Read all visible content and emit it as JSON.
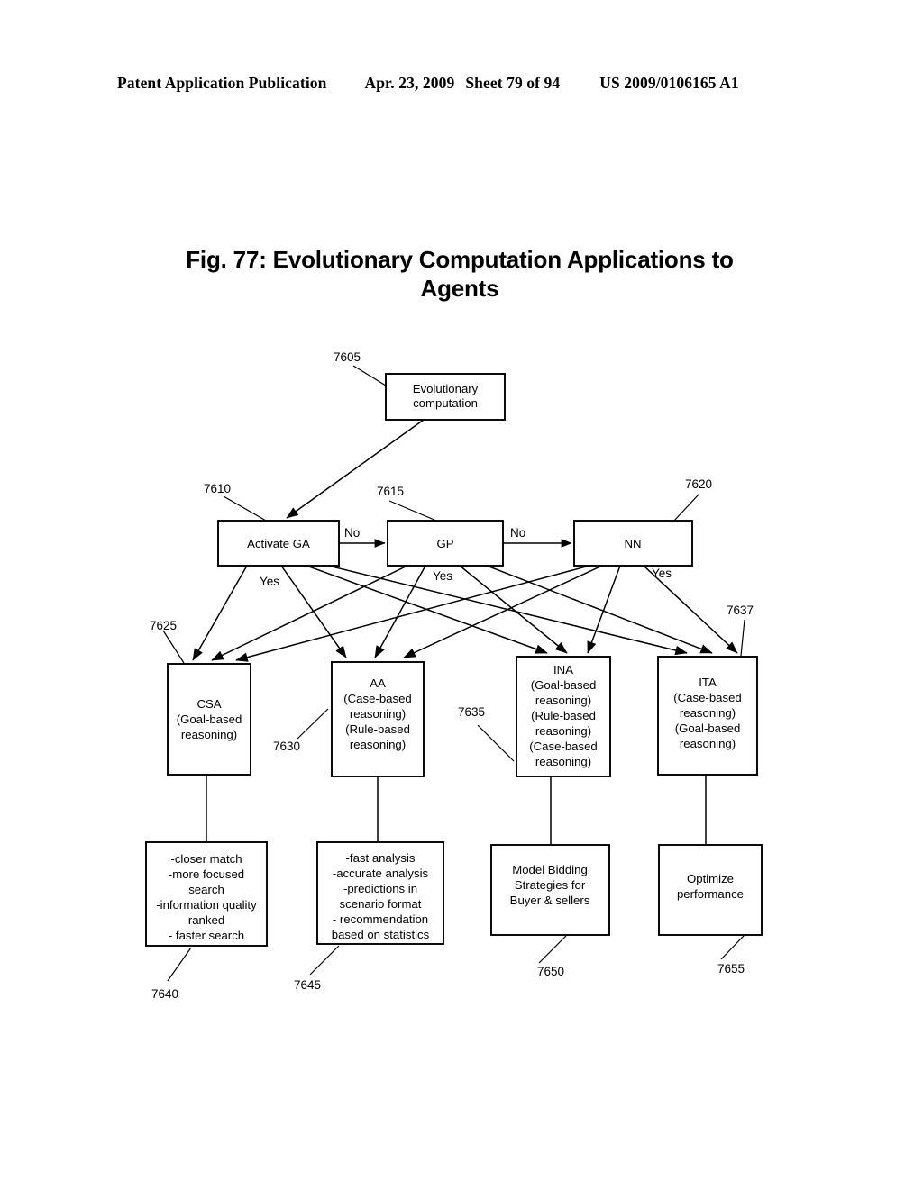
{
  "header": {
    "publication": "Patent Application Publication",
    "date": "Apr. 23, 2009",
    "sheet": "Sheet 79 of 94",
    "patent_number": "US 2009/0106165 A1"
  },
  "figure": {
    "title_line1": "Fig. 77: Evolutionary Computation Applications to",
    "title_line2": "Agents"
  },
  "nodes": {
    "evolutionary_computation": {
      "ref": "7605",
      "lines": [
        "Evolutionary",
        "computation"
      ]
    },
    "activate_ga": {
      "ref": "7610",
      "lines": [
        "Activate GA"
      ]
    },
    "gp": {
      "ref": "7615",
      "lines": [
        "GP"
      ]
    },
    "nn": {
      "ref": "7620",
      "lines": [
        "NN"
      ]
    },
    "csa": {
      "ref": "7625",
      "lines": [
        "CSA",
        "(Goal-based",
        "reasoning)"
      ]
    },
    "aa": {
      "ref": "7630",
      "lines": [
        "AA",
        "(Case-based",
        "reasoning)",
        "(Rule-based",
        "reasoning)"
      ]
    },
    "ina": {
      "ref": "7635",
      "lines": [
        "INA",
        "(Goal-based",
        "reasoning)",
        "(Rule-based",
        "reasoning)",
        "(Case-based",
        "reasoning)"
      ]
    },
    "ita": {
      "ref": "7637",
      "lines": [
        "ITA",
        "(Case-based",
        "reasoning)",
        "(Goal-based",
        "reasoning)"
      ]
    },
    "csa_outcome": {
      "ref": "7640",
      "lines": [
        "-closer match",
        "-more focused",
        "search",
        "-information quality",
        "ranked",
        "- faster search"
      ]
    },
    "aa_outcome": {
      "ref": "7645",
      "lines": [
        "-fast analysis",
        "-accurate analysis",
        "-predictions in",
        "scenario format",
        "- recommendation",
        "based on statistics"
      ]
    },
    "ina_outcome": {
      "ref": "7650",
      "lines": [
        "Model Bidding",
        "Strategies for",
        "Buyer & sellers"
      ]
    },
    "ita_outcome": {
      "ref": "7655",
      "lines": [
        "Optimize",
        "performance"
      ]
    }
  },
  "edge_labels": {
    "ga_to_gp": "No",
    "gp_to_nn": "No",
    "ga_yes": "Yes",
    "gp_yes": "Yes",
    "nn_yes": "Yes"
  },
  "colors": {
    "ink": "#000000",
    "paper": "#ffffff"
  }
}
